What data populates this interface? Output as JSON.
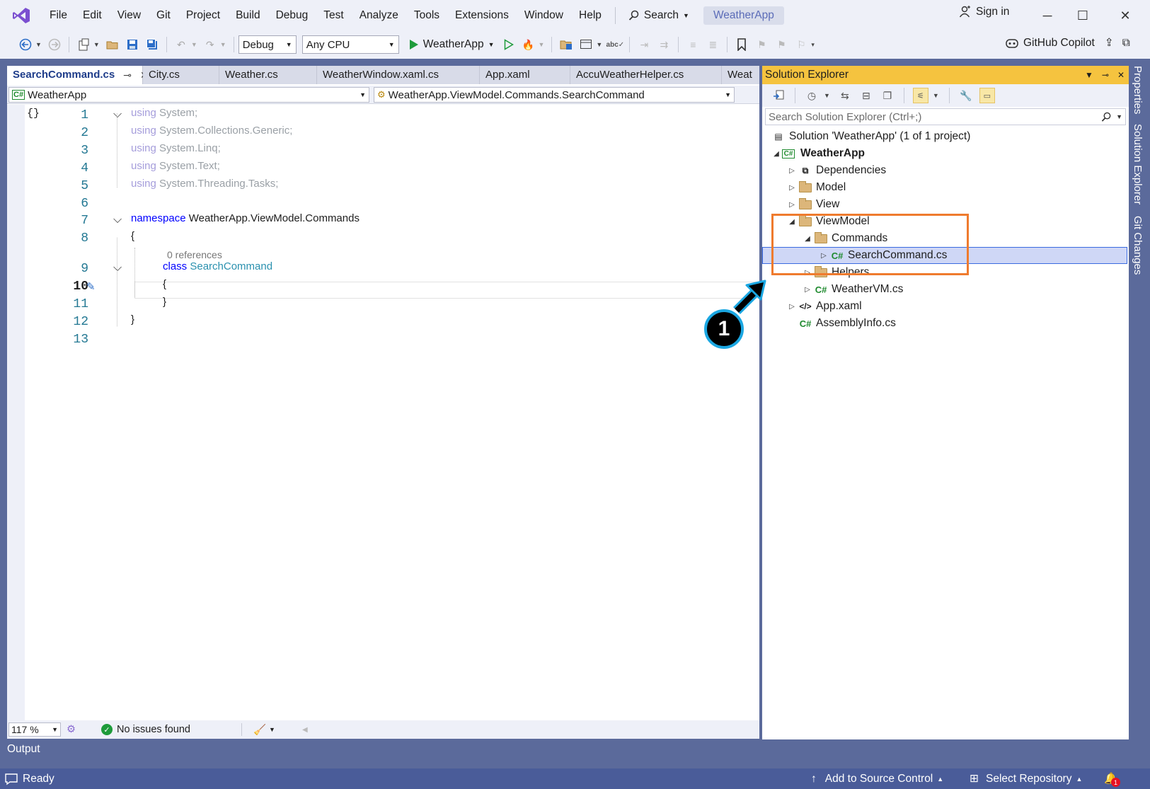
{
  "menu": {
    "items": [
      "File",
      "Edit",
      "View",
      "Git",
      "Project",
      "Build",
      "Debug",
      "Test",
      "Analyze",
      "Tools",
      "Extensions",
      "Window",
      "Help"
    ],
    "search_label": "Search",
    "solution_name": "WeatherApp",
    "sign_in": "Sign in"
  },
  "toolbar": {
    "config": "Debug",
    "platform": "Any CPU",
    "run_target": "WeatherApp",
    "copilot": "GitHub Copilot"
  },
  "editor": {
    "tabs": [
      "SearchCommand.cs",
      "City.cs",
      "Weather.cs",
      "WeatherWindow.xaml.cs",
      "App.xaml",
      "AccuWeatherHelper.cs",
      "Weat"
    ],
    "nav_project": "WeatherApp",
    "nav_scope": "WeatherApp.ViewModel.Commands.SearchCommand",
    "lines": [
      {
        "n": "1",
        "kw": "using",
        "rest": " System;"
      },
      {
        "n": "2",
        "kw": "using",
        "rest": " System.Collections.Generic;"
      },
      {
        "n": "3",
        "kw": "using",
        "rest": " System.Linq;"
      },
      {
        "n": "4",
        "kw": "using",
        "rest": " System.Text;"
      },
      {
        "n": "5",
        "kw": "using",
        "rest": " System.Threading.Tasks;"
      },
      {
        "n": "6"
      },
      {
        "n": "7",
        "kw": "namespace",
        "rest": " WeatherApp.ViewModel.Commands"
      },
      {
        "n": "8",
        "rest": "{"
      },
      {
        "n": "9",
        "kw": "class",
        "type": "SearchCommand"
      },
      {
        "n": "10",
        "rest": "{"
      },
      {
        "n": "11",
        "rest": "}"
      },
      {
        "n": "12",
        "rest": "}"
      },
      {
        "n": "13"
      }
    ],
    "codelens": "0 references",
    "zoom": "117 %",
    "issues": "No issues found"
  },
  "solution_explorer": {
    "title": "Solution Explorer",
    "search_placeholder": "Search Solution Explorer (Ctrl+;)",
    "tree": [
      {
        "label": "Solution 'WeatherApp' (1 of 1 project)",
        "icon": "solution-icon",
        "expander": ""
      },
      {
        "label": "WeatherApp",
        "icon": "csproj-icon",
        "expander": "expanded",
        "bold": true
      },
      {
        "label": "Dependencies",
        "icon": "dependencies-icon",
        "expander": "collapsed"
      },
      {
        "label": "Model",
        "icon": "folder-icon",
        "expander": "collapsed"
      },
      {
        "label": "View",
        "icon": "folder-icon",
        "expander": "collapsed"
      },
      {
        "label": "ViewModel",
        "icon": "folder-icon",
        "expander": "expanded"
      },
      {
        "label": "Commands",
        "icon": "folder-icon",
        "expander": "expanded"
      },
      {
        "label": "SearchCommand.cs",
        "icon": "csharp-file-icon",
        "expander": "collapsed",
        "selected": true
      },
      {
        "label": "Helpers",
        "icon": "folder-icon",
        "expander": "collapsed"
      },
      {
        "label": "WeatherVM.cs",
        "icon": "csharp-file-icon",
        "expander": "collapsed"
      },
      {
        "label": "App.xaml",
        "icon": "xaml-icon",
        "expander": "collapsed"
      },
      {
        "label": "AssemblyInfo.cs",
        "icon": "csharp-file-icon",
        "expander": ""
      }
    ]
  },
  "side_rail": [
    "Properties",
    "Solution Explorer",
    "Git Changes"
  ],
  "output_tab": "Output",
  "callout_number": "1",
  "statusbar": {
    "ready": "Ready",
    "add_source": "Add to Source Control",
    "select_repo": "Select Repository",
    "notif_count": "1"
  },
  "colors": {
    "accent_orange": "#ef7b2e",
    "callout_blue": "#1ba7e2",
    "statusbar_bg": "#4a5c99",
    "se_title_bg": "#f5c33f"
  }
}
